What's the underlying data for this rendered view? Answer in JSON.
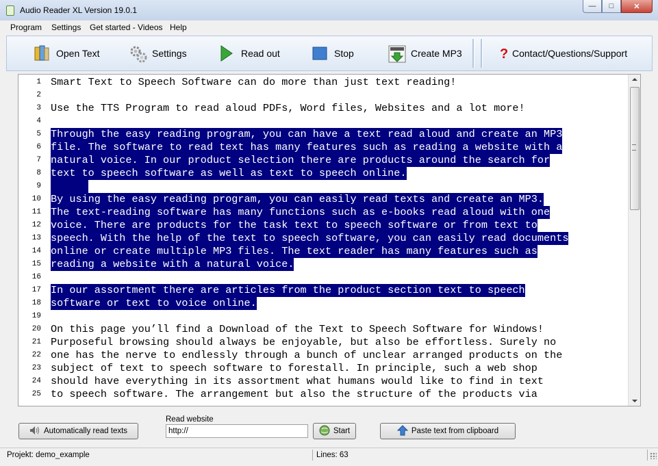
{
  "window": {
    "title": "Audio Reader XL Version 19.0.1",
    "min": "—",
    "max": "□",
    "close": "✕"
  },
  "menu": [
    "Program",
    "Settings",
    "Get started - Videos",
    "Help"
  ],
  "toolbar": {
    "open_text": "Open Text",
    "settings": "Settings",
    "read_out": "Read out",
    "stop": "Stop",
    "create_mp3": "Create MP3",
    "contact": "Contact/Questions/Support"
  },
  "editor": {
    "lines": [
      {
        "n": "1",
        "t": "Smart Text to Speech Software can do more than just text reading!",
        "sel": false
      },
      {
        "n": "2",
        "t": "",
        "sel": false
      },
      {
        "n": "3",
        "t": "Use the TTS Program to read aloud PDFs, Word files, Websites and a lot more!",
        "sel": false
      },
      {
        "n": "4",
        "t": "",
        "sel": false
      },
      {
        "n": "5",
        "t": "Through the easy reading program, you can have a text read aloud and create an MP3",
        "sel": true
      },
      {
        "n": "6",
        "t": "file. The software to read text has many features such as reading a website with a",
        "sel": true
      },
      {
        "n": "7",
        "t": "natural voice. In our product selection there are products around the search for",
        "sel": true
      },
      {
        "n": "8",
        "t": "text to speech software as well as text to speech online.",
        "sel": true
      },
      {
        "n": "9",
        "t": "      ",
        "sel": true
      },
      {
        "n": "10",
        "t": "By using the easy reading program, you can easily read texts and create an MP3.",
        "sel": true
      },
      {
        "n": "11",
        "t": "The text-reading software has many functions such as e-books read aloud with one",
        "sel": true
      },
      {
        "n": "12",
        "t": "voice. There are products for the task text to speech software or from text to",
        "sel": true
      },
      {
        "n": "13",
        "t": "speech. With the help of the text to speech software, you can easily read documents",
        "sel": true
      },
      {
        "n": "14",
        "t": "online or create multiple MP3 files. The text reader has many features such as",
        "sel": true
      },
      {
        "n": "15",
        "t": "reading a website with a natural voice.",
        "sel": true
      },
      {
        "n": "16",
        "t": "",
        "sel": false
      },
      {
        "n": "17",
        "t": "In our assortment there are articles from the product section text to speech",
        "sel": true
      },
      {
        "n": "18",
        "t": "software or text to voice online.",
        "sel": true
      },
      {
        "n": "19",
        "t": "",
        "sel": false
      },
      {
        "n": "20",
        "t": "On this page you’ll find a Download of the Text to Speech Software for Windows!",
        "sel": false
      },
      {
        "n": "21",
        "t": "Purposeful browsing should always be enjoyable, but also be effortless. Surely no",
        "sel": false
      },
      {
        "n": "22",
        "t": "one has the nerve to endlessly through a bunch of unclear arranged products on the",
        "sel": false
      },
      {
        "n": "23",
        "t": "subject of text to speech software to forestall. In principle, such a web shop",
        "sel": false
      },
      {
        "n": "24",
        "t": "should have everything in its assortment what humans would like to find in text",
        "sel": false
      },
      {
        "n": "25",
        "t": "to speech software. The arrangement but also the structure of the products via",
        "sel": false
      }
    ]
  },
  "bottom": {
    "auto_read": "Automatically read texts",
    "read_website_label": "Read website",
    "url_value": "http://",
    "start": "Start",
    "paste": "Paste text from clipboard"
  },
  "status": {
    "project": "Projekt: demo_example",
    "lines": "Lines: 63"
  },
  "colors": {
    "selection": "#000080",
    "toolbar_bg": "#dde8f5"
  }
}
